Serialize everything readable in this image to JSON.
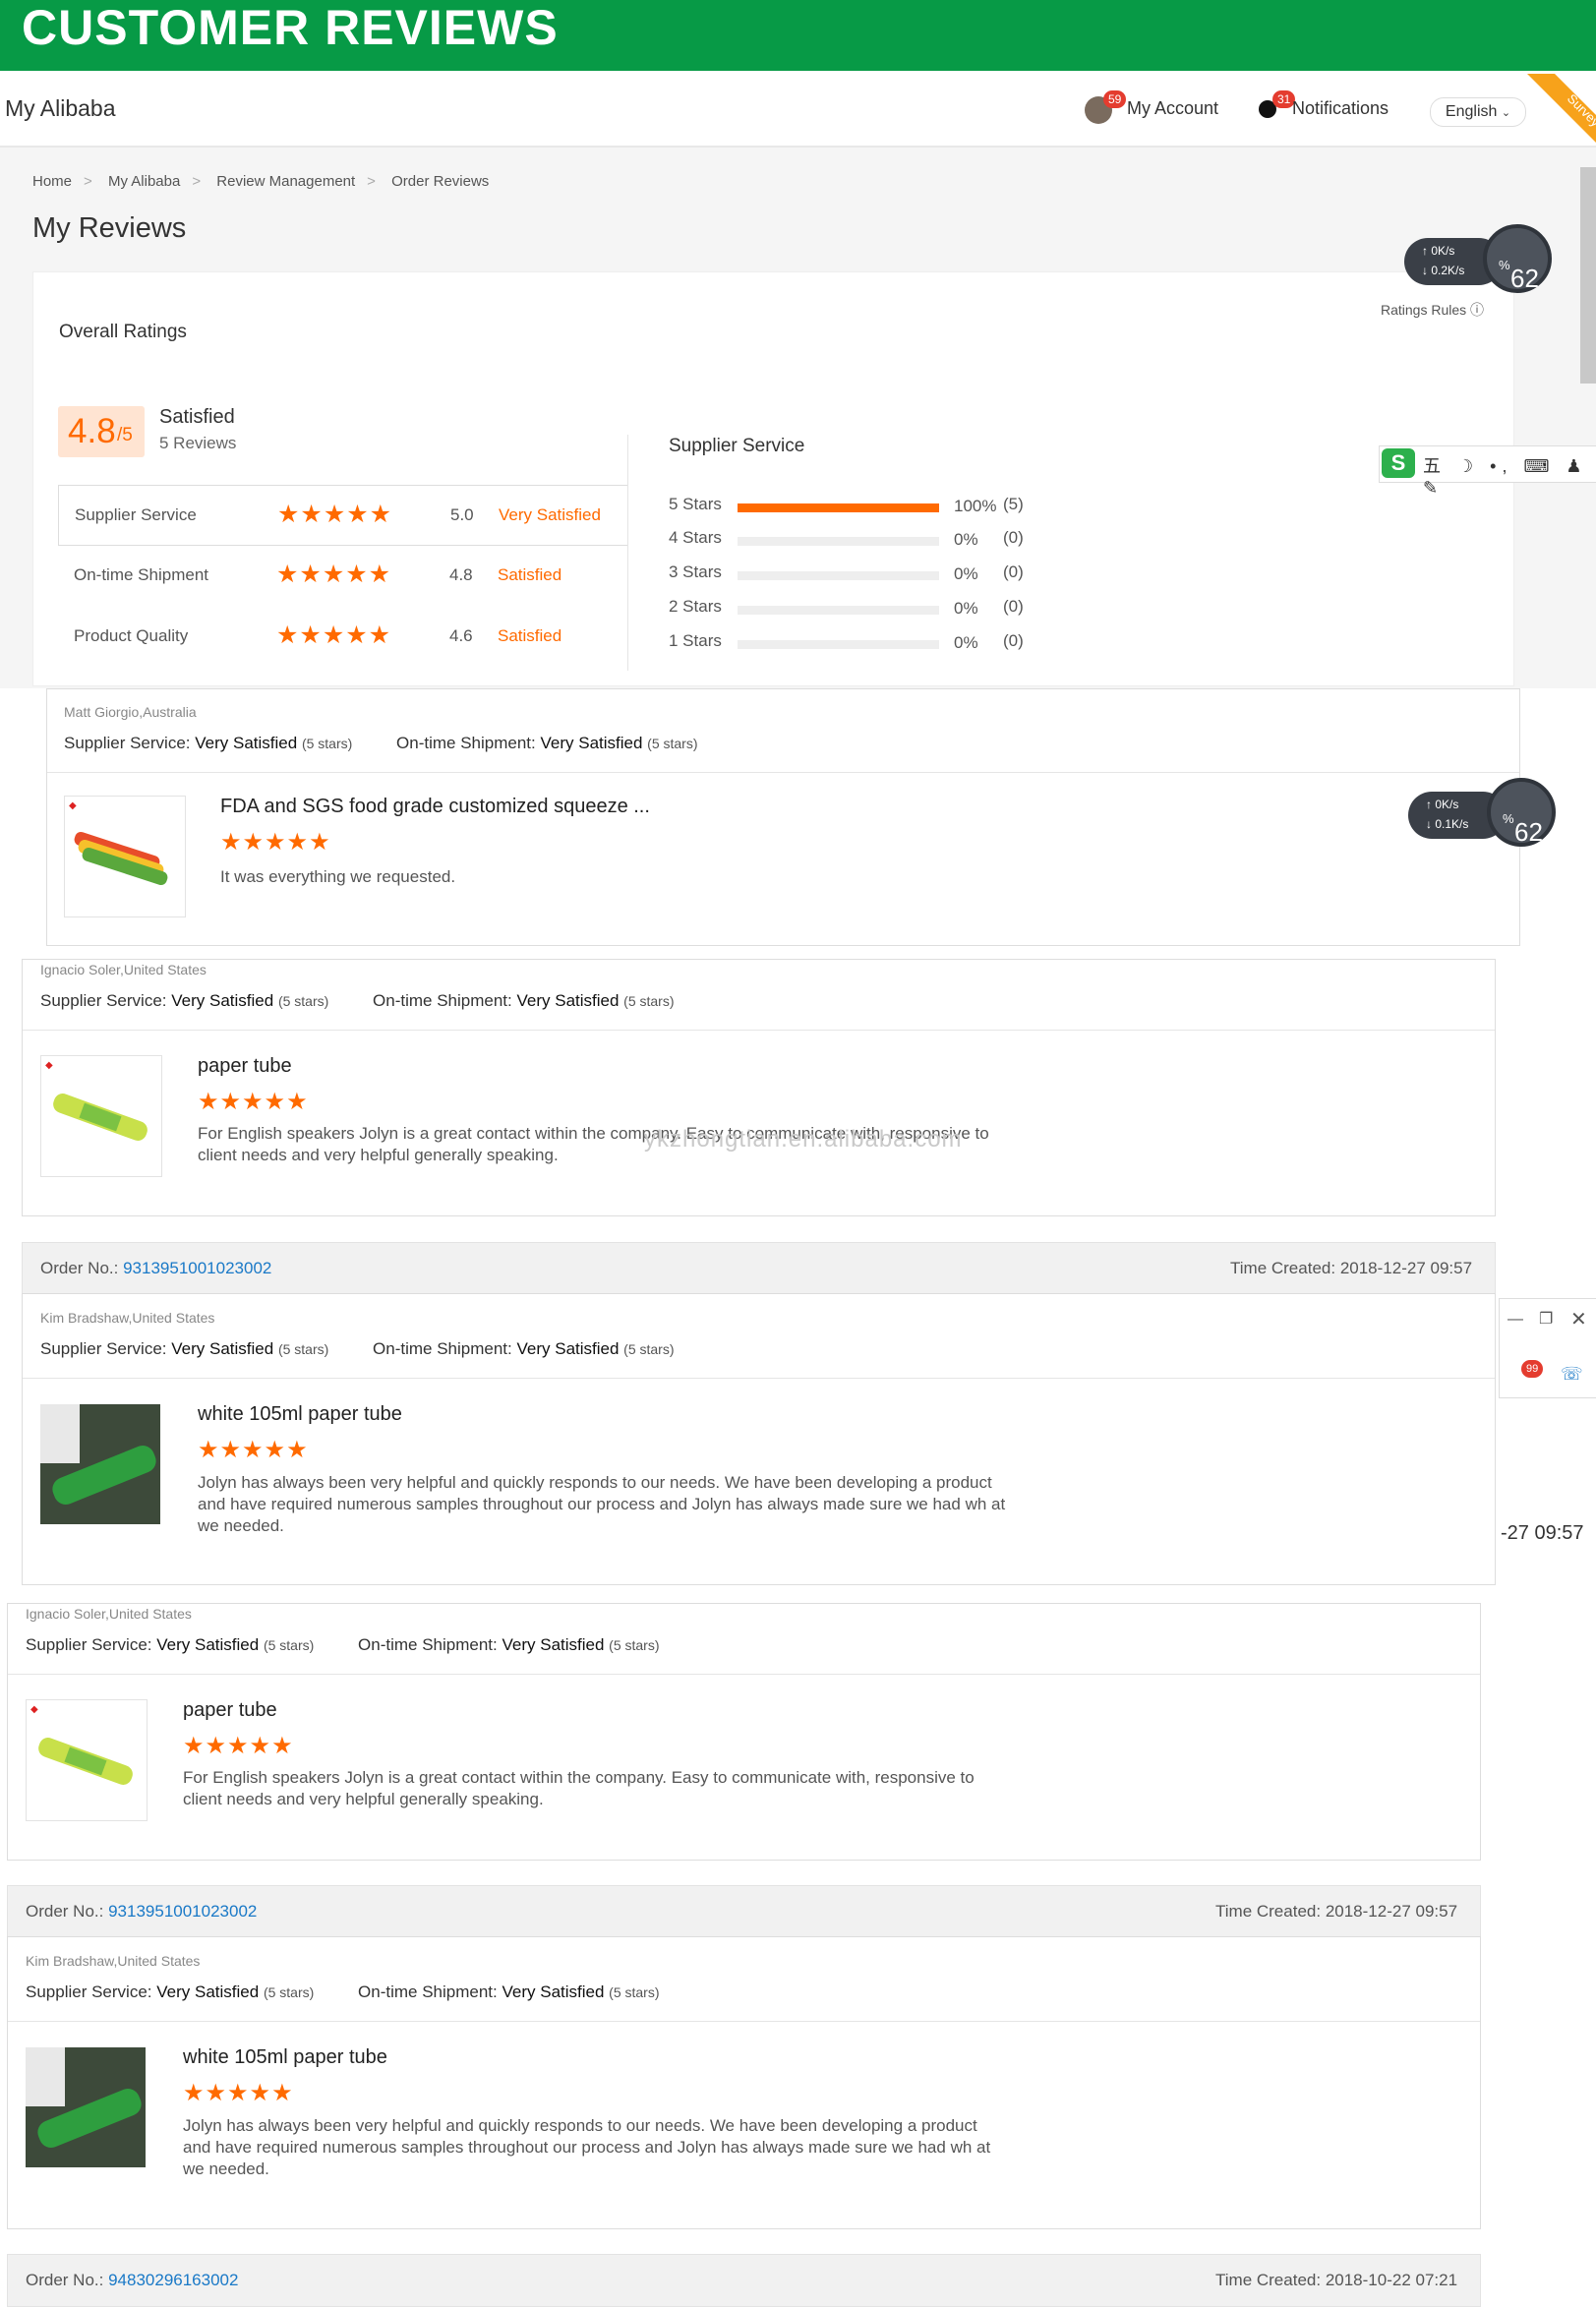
{
  "banner": {
    "title": "CUSTOMER REVIEWS"
  },
  "nav": {
    "brand": "My Alibaba",
    "account_label": "My Account",
    "account_badge": "59",
    "notifications_label": "Notifications",
    "notifications_badge": "31",
    "language": "English",
    "survey": "Survey"
  },
  "breadcrumb": [
    "Home",
    "My Alibaba",
    "Review Management",
    "Order Reviews"
  ],
  "page_title": "My Reviews",
  "overall": {
    "title": "Overall Ratings",
    "rules_label": "Ratings Rules",
    "score": "4.8",
    "score_max": "/5",
    "score_label": "Satisfied",
    "reviews_count": "5 Reviews",
    "rows": [
      {
        "name": "Supplier Service",
        "stars": "★★★★★",
        "value": "5.0",
        "level": "Very Satisfied"
      },
      {
        "name": "On-time Shipment",
        "stars": "★★★★★",
        "value": "4.8",
        "level": "Satisfied"
      },
      {
        "name": "Product Quality",
        "stars": "★★★★★",
        "value": "4.6",
        "level": "Satisfied"
      }
    ]
  },
  "supplier_service": {
    "title": "Supplier Service",
    "bars": [
      {
        "label": "5 Stars",
        "fill": 1.0,
        "pct": "100%",
        "count": "(5)"
      },
      {
        "label": "4 Stars",
        "fill": 0,
        "pct": "0%",
        "count": "(0)"
      },
      {
        "label": "3 Stars",
        "fill": 0,
        "pct": "0%",
        "count": "(0)"
      },
      {
        "label": "2 Stars",
        "fill": 0,
        "pct": "0%",
        "count": "(0)"
      },
      {
        "label": "1 Stars",
        "fill": 0,
        "pct": "0%",
        "count": "(0)"
      }
    ]
  },
  "speed_widget": {
    "up": "0K/s",
    "down1": "0.2K/s",
    "down2": "0.1K/s",
    "percent": "62",
    "percent_unit": "%"
  },
  "labels": {
    "supplier_service": "Supplier Service:",
    "on_time_shipment": "On-time Shipment:",
    "very_satisfied": "Very Satisfied",
    "five_stars": "(5 stars)",
    "order_no": "Order No.:",
    "time_created": "Time Created:"
  },
  "reviews": [
    {
      "reviewer": "Matt Giorgio,Australia",
      "product": "FDA and SGS food grade customized squeeze ...",
      "stars": "★★★★★",
      "text": "It was everything we requested."
    },
    {
      "reviewer": "Ignacio Soler,United States",
      "product": "paper tube",
      "stars": "★★★★★",
      "text": "For English speakers Jolyn is a great contact within the company. Easy to communicate with, responsive to client needs and very helpful generally speaking."
    },
    {
      "order_no": "9313951001023002",
      "time_created": "2018-12-27 09:57",
      "reviewer": "Kim Bradshaw,United States",
      "product": "white 105ml paper tube",
      "stars": "★★★★★",
      "text": "Jolyn has always been very helpful and quickly responds to our needs.  We have been developing a product and have required numerous samples throughout our process and Jolyn has always made sure we had wh at we needed."
    },
    {
      "reviewer": "Ignacio Soler,United States",
      "product": "paper tube",
      "stars": "★★★★★",
      "text": "For English speakers Jolyn is a great contact within the company. Easy to communicate with, responsive to client needs and very helpful generally speaking."
    },
    {
      "order_no": "9313951001023002",
      "time_created": "2018-12-27 09:57",
      "reviewer": "Kim Bradshaw,United States",
      "product": "white 105ml paper tube",
      "stars": "★★★★★",
      "text": "Jolyn has always been very helpful and quickly responds to our needs.  We have been developing a product and have required numerous samples throughout our process and Jolyn has always made sure we had wh at we needed."
    }
  ],
  "last_order": {
    "order_no": "94830296163002",
    "time_created": "2018-10-22 07:21"
  },
  "watermark": "ykzhongtian.en.alibaba.com",
  "fragment_time": "-27 09:57",
  "fragment_badge": "99",
  "colors": {
    "brand_green": "#079a46",
    "accent": "#ff6a00",
    "link": "#1a79c7"
  }
}
